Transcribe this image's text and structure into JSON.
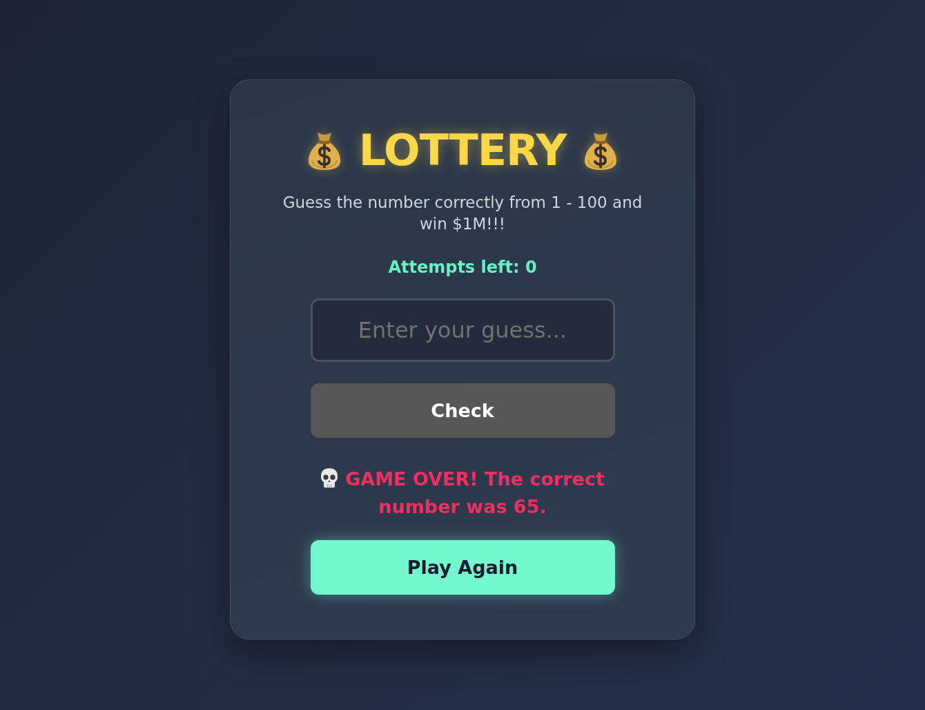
{
  "title": "LOTTERY",
  "subtitle": "Guess the number correctly from 1 - 100 and win $1M!!!",
  "attempts": "Attempts left: 0",
  "guess_field": {
    "placeholder": "Enter your guess..."
  },
  "check_button": {
    "label": "Check",
    "disabled": true
  },
  "message": {
    "kind": "lose",
    "text": "GAME OVER! The correct number was 65."
  },
  "play_again_button": {
    "label": "Play Again"
  }
}
